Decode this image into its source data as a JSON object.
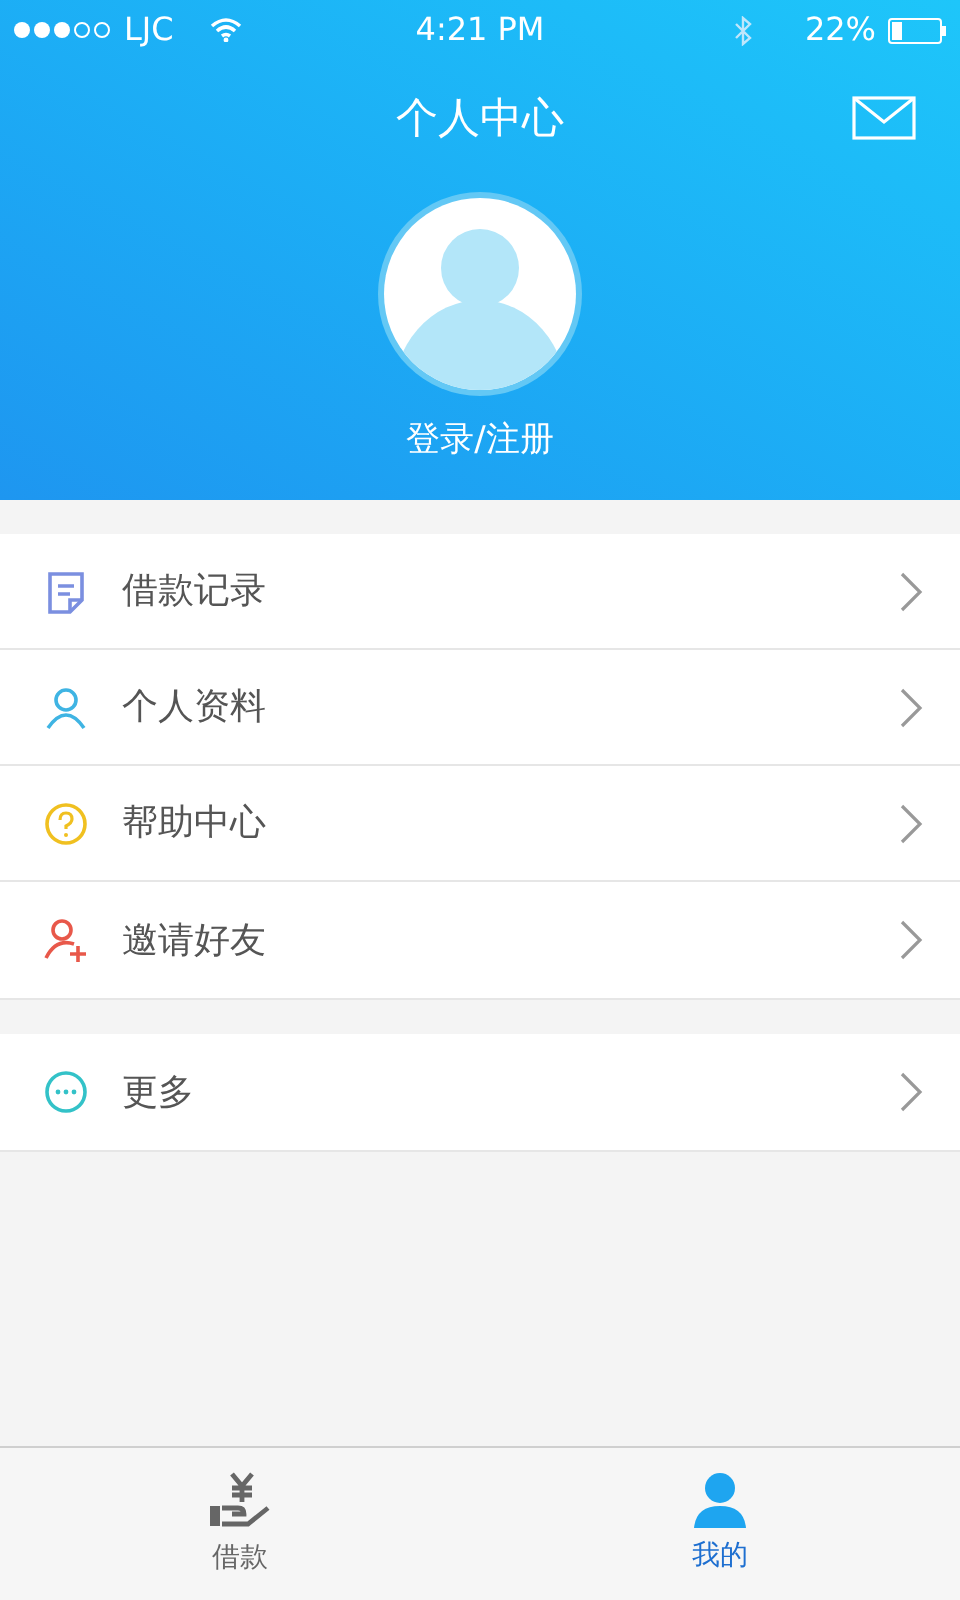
{
  "status_bar": {
    "carrier": "LJC",
    "time": "4:21 PM",
    "battery": "22%"
  },
  "header": {
    "title": "个人中心",
    "login_link": "登录/注册"
  },
  "menu_groups": [
    {
      "items": [
        {
          "kind": "records",
          "label": "借款记录",
          "color": "#7b8fe0"
        },
        {
          "kind": "profile",
          "label": "个人资料",
          "color": "#3fb4e3"
        },
        {
          "kind": "help",
          "label": "帮助中心",
          "color": "#f0c020"
        },
        {
          "kind": "invite",
          "label": "邀请好友",
          "color": "#e8584a"
        }
      ]
    },
    {
      "items": [
        {
          "kind": "more",
          "label": "更多",
          "color": "#33c2c8"
        }
      ]
    }
  ],
  "tab_bar": [
    {
      "kind": "loan",
      "label": "借款",
      "selected": false
    },
    {
      "kind": "mine",
      "label": "我的",
      "selected": true
    }
  ]
}
